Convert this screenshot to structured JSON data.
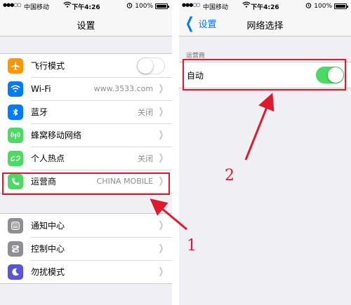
{
  "status_bar": {
    "signal": "●●●○○",
    "carrier": "中国移动",
    "time": "下午4:26",
    "battery": "100%"
  },
  "left_screen": {
    "title": "设置",
    "group1": [
      {
        "label": "飞行模式",
        "icon": "airplane-icon",
        "color": "#ff9500",
        "control": "toggle",
        "toggle_on": false
      },
      {
        "label": "Wi-Fi",
        "icon": "wifi-icon",
        "color": "#007aff",
        "value": "www.3533.com"
      },
      {
        "label": "蓝牙",
        "icon": "bluetooth-icon",
        "color": "#007aff",
        "value": "关闭"
      },
      {
        "label": "蜂窝移动网络",
        "icon": "cellular-icon",
        "color": "#4cd964",
        "value": ""
      },
      {
        "label": "个人热点",
        "icon": "hotspot-icon",
        "color": "#4cd964",
        "value": "关闭"
      },
      {
        "label": "运营商",
        "icon": "phone-icon",
        "color": "#4cd964",
        "value": "CHINA MOBILE"
      }
    ],
    "group2": [
      {
        "label": "通知中心",
        "icon": "notification-center-icon",
        "color": "#8e8e93"
      },
      {
        "label": "控制中心",
        "icon": "control-center-icon",
        "color": "#8e8e93"
      },
      {
        "label": "勿扰模式",
        "icon": "moon-icon",
        "color": "#5856d6"
      }
    ]
  },
  "right_screen": {
    "back_label": "设置",
    "title": "网络选择",
    "section_header": "运营商",
    "auto_label": "自动",
    "auto_on": true
  },
  "annotations": {
    "left_number": "1",
    "right_number": "2",
    "highlight_color": "#e0192d"
  },
  "colors": {
    "ios_blue": "#007aff",
    "ios_green": "#4cd964",
    "background": "#efeff4"
  }
}
